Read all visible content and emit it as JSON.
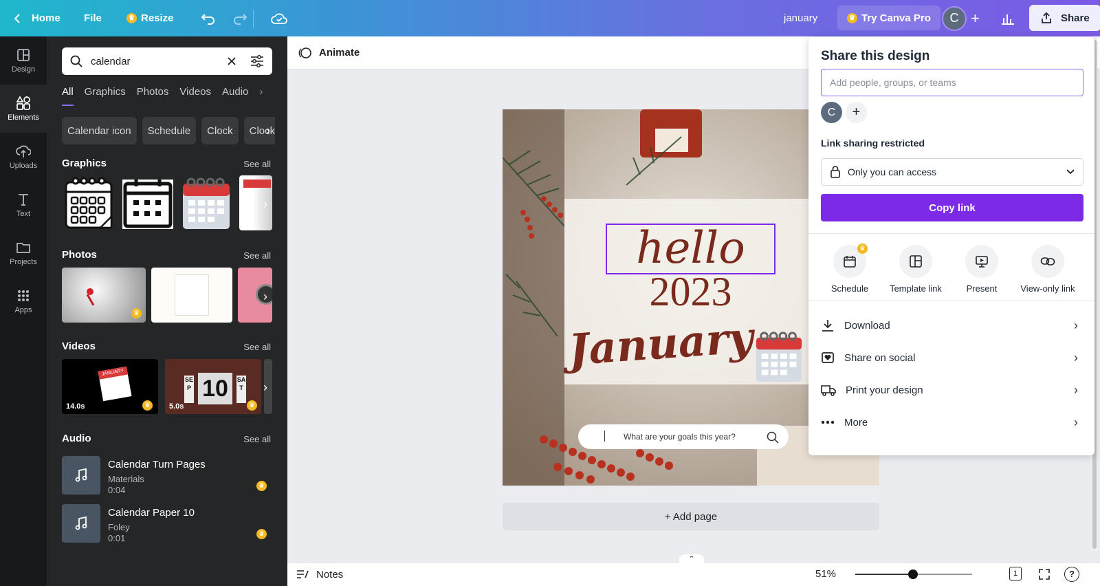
{
  "topbar": {
    "home": "Home",
    "file": "File",
    "resize": "Resize",
    "design_name": "january",
    "try_pro": "Try Canva Pro",
    "avatar_initial": "C",
    "share": "Share"
  },
  "rail": [
    {
      "label": "Design",
      "icon": "design-icon"
    },
    {
      "label": "Elements",
      "icon": "elements-icon"
    },
    {
      "label": "Uploads",
      "icon": "uploads-icon"
    },
    {
      "label": "Text",
      "icon": "text-icon"
    },
    {
      "label": "Projects",
      "icon": "projects-icon"
    },
    {
      "label": "Apps",
      "icon": "apps-icon"
    }
  ],
  "panel": {
    "search_value": "calendar",
    "tabs": [
      "All",
      "Graphics",
      "Photos",
      "Videos",
      "Audio"
    ],
    "chips": [
      "Calendar icon",
      "Schedule",
      "Clock",
      "Clock"
    ],
    "graphics_title": "Graphics",
    "photos_title": "Photos",
    "videos_title": "Videos",
    "audio_title": "Audio",
    "see_all": "See all",
    "videos": [
      {
        "duration": "14.0s",
        "caption": "JANUARY"
      },
      {
        "duration": "5.0s",
        "caption": "10",
        "left": "SEP",
        "right": "SAT"
      }
    ],
    "audio": [
      {
        "title": "Calendar Turn Pages",
        "artist": "Materials",
        "duration": "0:04"
      },
      {
        "title": "Calendar Paper 10",
        "artist": "Foley",
        "duration": "0:01"
      }
    ]
  },
  "workspace": {
    "animate": "Animate",
    "add_page": "+ Add page",
    "notes": "Notes",
    "zoom": "51%",
    "page_number": "1",
    "help": "?"
  },
  "design": {
    "hello": "hello",
    "year": "2023",
    "month": "January",
    "goals": "What are your goals this year?"
  },
  "share_panel": {
    "title": "Share this design",
    "add_placeholder": "Add people, groups, or teams",
    "member_initial": "C",
    "link_label": "Link sharing restricted",
    "access": "Only you can access",
    "copy_link": "Copy link",
    "options": [
      "Schedule",
      "Template link",
      "Present",
      "View-only link"
    ],
    "rows": [
      "Download",
      "Share on social",
      "Print your design",
      "More"
    ]
  },
  "colors": {
    "accent": "#7d2ae8",
    "rail_bg": "#18191b",
    "panel_bg": "#252627",
    "calendar_red": "#d83a3a",
    "script_brown": "#7a2a1d"
  }
}
